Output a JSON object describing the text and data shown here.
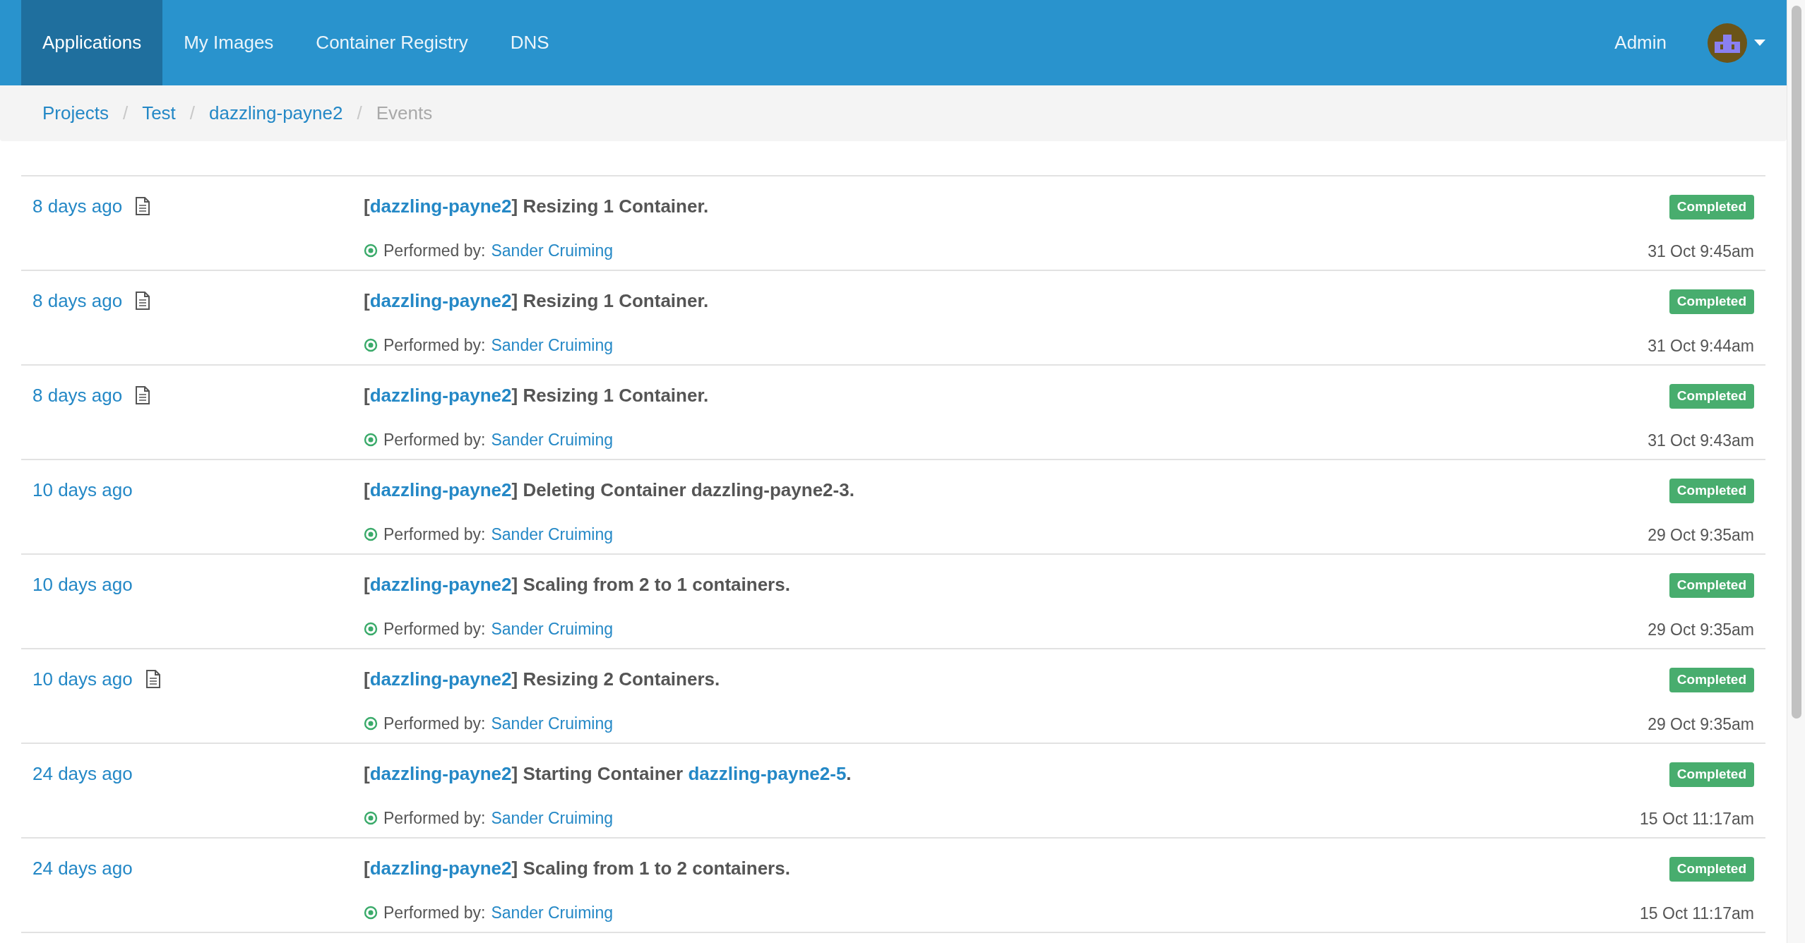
{
  "nav": {
    "tabs": [
      {
        "label": "Applications",
        "selected": true
      },
      {
        "label": "My Images",
        "selected": false
      },
      {
        "label": "Container Registry",
        "selected": false
      },
      {
        "label": "DNS",
        "selected": false
      }
    ],
    "user_label": "Admin"
  },
  "breadcrumb": [
    {
      "label": "Projects",
      "current": false
    },
    {
      "separator": "/",
      "label": "Test",
      "current": false
    },
    {
      "separator": "/",
      "label": "dazzling-payne2",
      "current": false
    },
    {
      "separator": "/",
      "label": "Events",
      "current": true
    }
  ],
  "events": [
    {
      "time": "8 days ago",
      "log": true,
      "title": [
        {
          "text": "[",
          "link": false
        },
        {
          "text": "dazzling-payne2",
          "link": true
        },
        {
          "text": "] Resizing 1 Container.",
          "link": false
        }
      ],
      "status": "Completed",
      "performed_label": "Performed by:",
      "user": "Sander Cruiming",
      "date": "31 Oct 9:45am"
    },
    {
      "time": "8 days ago",
      "log": true,
      "title": [
        {
          "text": "[",
          "link": false
        },
        {
          "text": "dazzling-payne2",
          "link": true
        },
        {
          "text": "] Resizing 1 Container.",
          "link": false
        }
      ],
      "status": "Completed",
      "performed_label": "Performed by:",
      "user": "Sander Cruiming",
      "date": "31 Oct 9:44am"
    },
    {
      "time": "8 days ago",
      "log": true,
      "title": [
        {
          "text": "[",
          "link": false
        },
        {
          "text": "dazzling-payne2",
          "link": true
        },
        {
          "text": "] Resizing 1 Container.",
          "link": false
        }
      ],
      "status": "Completed",
      "performed_label": "Performed by:",
      "user": "Sander Cruiming",
      "date": "31 Oct 9:43am"
    },
    {
      "time": "10 days ago",
      "log": false,
      "title": [
        {
          "text": "[",
          "link": false
        },
        {
          "text": "dazzling-payne2",
          "link": true
        },
        {
          "text": "] Deleting Container dazzling-payne2-3.",
          "link": false
        }
      ],
      "status": "Completed",
      "performed_label": "Performed by:",
      "user": "Sander Cruiming",
      "date": "29 Oct 9:35am"
    },
    {
      "time": "10 days ago",
      "log": false,
      "title": [
        {
          "text": "[",
          "link": false
        },
        {
          "text": "dazzling-payne2",
          "link": true
        },
        {
          "text": "] Scaling from 2 to 1 containers.",
          "link": false
        }
      ],
      "status": "Completed",
      "performed_label": "Performed by:",
      "user": "Sander Cruiming",
      "date": "29 Oct 9:35am"
    },
    {
      "time": "10 days ago",
      "log": true,
      "title": [
        {
          "text": "[",
          "link": false
        },
        {
          "text": "dazzling-payne2",
          "link": true
        },
        {
          "text": "] Resizing 2 Containers.",
          "link": false
        }
      ],
      "status": "Completed",
      "performed_label": "Performed by:",
      "user": "Sander Cruiming",
      "date": "29 Oct 9:35am"
    },
    {
      "time": "24 days ago",
      "log": false,
      "title": [
        {
          "text": "[",
          "link": false
        },
        {
          "text": "dazzling-payne2",
          "link": true
        },
        {
          "text": "] Starting Container ",
          "link": false
        },
        {
          "text": "dazzling-payne2-5",
          "link": true
        },
        {
          "text": ".",
          "link": false
        }
      ],
      "status": "Completed",
      "performed_label": "Performed by:",
      "user": "Sander Cruiming",
      "date": "15 Oct 11:17am"
    },
    {
      "time": "24 days ago",
      "log": false,
      "title": [
        {
          "text": "[",
          "link": false
        },
        {
          "text": "dazzling-payne2",
          "link": true
        },
        {
          "text": "] Scaling from 1 to 2 containers.",
          "link": false
        }
      ],
      "status": "Completed",
      "performed_label": "Performed by:",
      "user": "Sander Cruiming",
      "date": "15 Oct 11:17am"
    }
  ]
}
